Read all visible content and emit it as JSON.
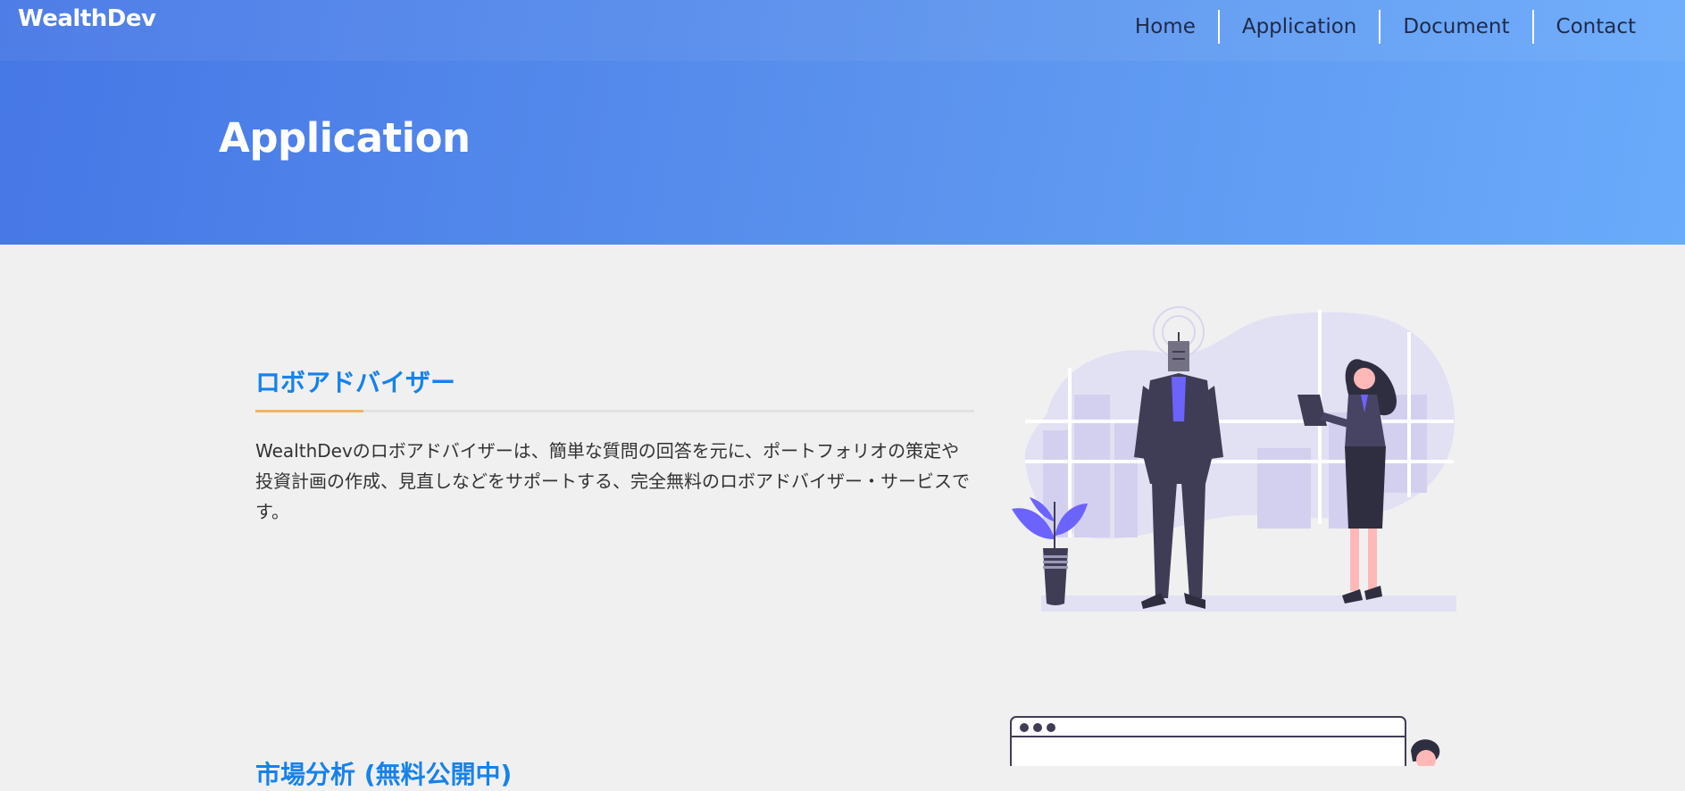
{
  "header": {
    "brand": "WealthDev",
    "nav": [
      "Home",
      "Application",
      "Document",
      "Contact"
    ]
  },
  "hero": {
    "title": "Application"
  },
  "sections": [
    {
      "title": "ロボアドバイザー",
      "description": "WealthDevのロボアドバイザーは、簡単な質問の回答を元に、ポートフォリオの策定や投資計画の作成、見直しなどをサポートする、完全無料のロボアドバイザー・サービスです。",
      "illustration": "robot-and-businesswoman-illustration"
    },
    {
      "title": "市場分析 (無料公開中)",
      "illustration": "browser-window-person-illustration"
    }
  ],
  "colors": {
    "hero_gradient_start": "#4677e6",
    "hero_gradient_end": "#6aabfb",
    "section_title": "#1782ea",
    "accent_underline": "#f4b35d",
    "illustration_purple": "#6c63ff",
    "illustration_dark": "#3f3d56"
  }
}
